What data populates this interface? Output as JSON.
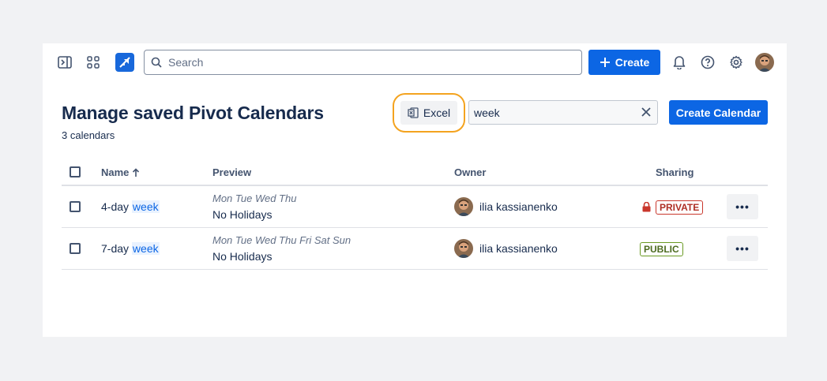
{
  "topbar": {
    "search_placeholder": "Search",
    "create_label": "Create",
    "icons": [
      "sidebar-toggle-icon",
      "app-switcher-icon",
      "product-logo-icon",
      "bell-icon",
      "help-icon",
      "gear-icon"
    ]
  },
  "page": {
    "title": "Manage saved Pivot Calendars",
    "count": "3 calendars",
    "excel_label": "Excel",
    "filter_value": "week",
    "create_calendar_label": "Create Calendar"
  },
  "table": {
    "columns": {
      "name": "Name",
      "preview": "Preview",
      "owner": "Owner",
      "sharing": "Sharing"
    },
    "rows": [
      {
        "name_prefix": "4-day ",
        "name_match": "week",
        "preview_days": "Mon Tue Wed Thu",
        "preview_holidays": "No Holidays",
        "owner": "ilia kassianenko",
        "sharing": "PRIVATE",
        "more": "•••"
      },
      {
        "name_prefix": "7-day ",
        "name_match": "week",
        "preview_days": "Mon Tue Wed Thu Fri Sat Sun",
        "preview_holidays": "No Holidays",
        "owner": "ilia kassianenko",
        "sharing": "PUBLIC",
        "more": "•••"
      }
    ]
  },
  "colors": {
    "primary": "#0c66e4",
    "highlight_ring": "#f4a31f",
    "private": "#c9372c",
    "public": "#6a9a23"
  }
}
